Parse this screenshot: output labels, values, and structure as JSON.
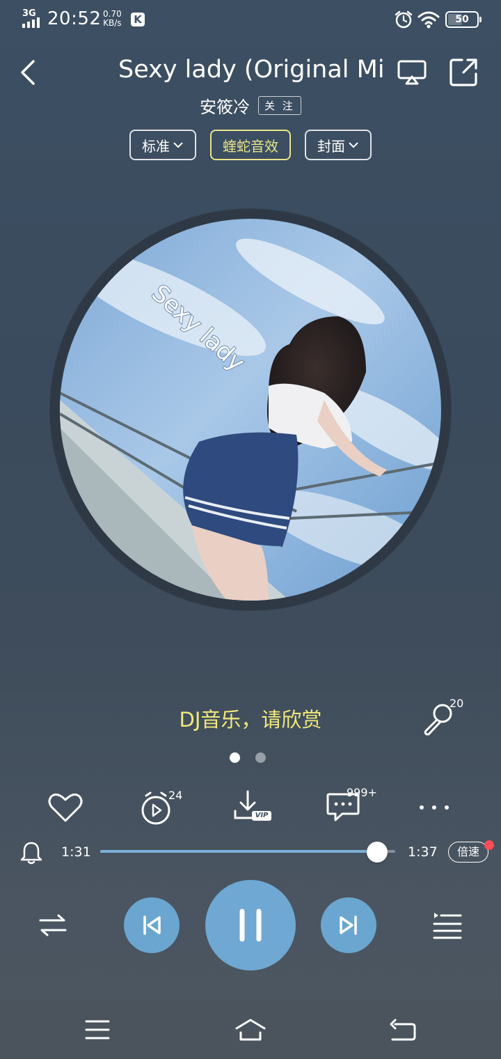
{
  "status_bar": {
    "network": "3G",
    "time": "20:52",
    "speed_value": "0.70",
    "speed_unit": "KB/s",
    "app_badge": "K",
    "battery": "50"
  },
  "header": {
    "song_title": "Sexy lady (Original Mi",
    "artist": "安筱冷",
    "follow_label": "关 注"
  },
  "chips": {
    "quality": "标准",
    "sound_effect": "蝰蛇音效",
    "cover_mode": "封面"
  },
  "cover": {
    "overlay_text": "Sexy lady"
  },
  "lyrics": {
    "current_line": "DJ音乐，请欣赏",
    "karaoke_count": "20"
  },
  "page_dots": {
    "count": 2,
    "active": 0
  },
  "actions": {
    "timer_count": "24",
    "download_badge": "VIP",
    "comments_count": "999+"
  },
  "progress": {
    "current": "1:31",
    "duration": "1:37",
    "played_fraction": 0.938,
    "speed_label": "倍速"
  },
  "colors": {
    "accent": "#6aa6cf",
    "lyric": "#f2ea7a",
    "effect_chip": "#e9e58a",
    "notify_dot": "#ff4d5a"
  }
}
